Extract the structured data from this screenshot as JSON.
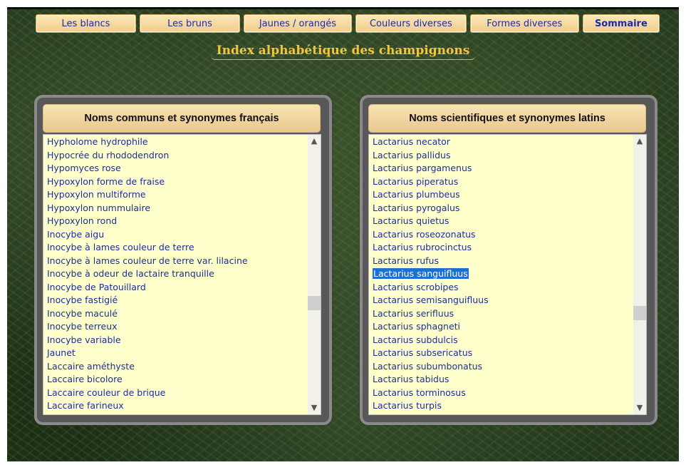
{
  "nav": {
    "items": [
      {
        "label": "Les blancs"
      },
      {
        "label": "Les bruns"
      },
      {
        "label": "Jaunes / orangés"
      },
      {
        "label": "Couleurs diverses"
      },
      {
        "label": "Formes diverses"
      },
      {
        "label": "Sommaire"
      }
    ]
  },
  "page_title": "Index alphabétique des champignons",
  "left_panel": {
    "heading": "Noms communs et synonymes français",
    "scroll_position": 0.62,
    "items": [
      "Hypholome hydrophile",
      "Hypocrée du rhododendron",
      "Hypomyces rose",
      "Hypoxylon forme de fraise",
      "Hypoxylon multiforme",
      "Hypoxylon nummulaire",
      "Hypoxylon rond",
      "Inocybe aigu",
      "Inocybe à lames couleur de terre",
      "Inocybe à lames couleur de terre var. lilacine",
      "Inocybe à odeur de lactaire tranquille",
      "Inocybe de Patouillard",
      "Inocybe fastigié",
      "Inocybe maculé",
      "Inocybe terreux",
      "Inocybe variable",
      "Jaunet",
      "Laccaire améthyste",
      "Laccaire bicolore",
      "Laccaire couleur de brique",
      "Laccaire farineux"
    ]
  },
  "right_panel": {
    "heading": "Noms scientifiques et synonymes latins",
    "scroll_position": 0.66,
    "selected": "Lactarius sanguifluus",
    "items": [
      "Lactarius necator",
      "Lactarius pallidus",
      "Lactarius pargamenus",
      "Lactarius piperatus",
      "Lactarius plumbeus",
      "Lactarius pyrogalus",
      "Lactarius quietus",
      "Lactarius roseozonatus",
      "Lactarius rubrocinctus",
      "Lactarius rufus",
      "Lactarius sanguifluus",
      "Lactarius scrobipes",
      "Lactarius semisanguifluus",
      "Lactarius serifluus",
      "Lactarius sphagneti",
      "Lactarius subdulcis",
      "Lactarius subsericatus",
      "Lactarius subumbonatus",
      "Lactarius tabidus",
      "Lactarius torminosus",
      "Lactarius turpis"
    ]
  },
  "colors": {
    "link_blue": "#1a2e9b",
    "title_gold": "#f4c53a",
    "list_bg": "#ffffcc",
    "selection_bg": "#1e6fd0"
  }
}
